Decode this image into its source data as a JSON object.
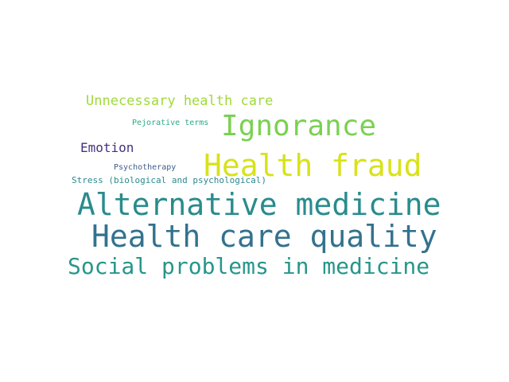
{
  "words": [
    {
      "text": "Unnecessary health care",
      "color": "#a0da39"
    },
    {
      "text": "Pejorative terms",
      "color": "#2aaa86"
    },
    {
      "text": "Ignorance",
      "color": "#7ad151"
    },
    {
      "text": "Emotion",
      "color": "#46327e"
    },
    {
      "text": "Psychotherapy",
      "color": "#3e5d8b"
    },
    {
      "text": "Health fraud",
      "color": "#d8e219"
    },
    {
      "text": "Stress (biological and psychological)",
      "color": "#2c8a8e"
    },
    {
      "text": "Alternative medicine",
      "color": "#2a8b8d"
    },
    {
      "text": "Health care quality",
      "color": "#33728e"
    },
    {
      "text": "Social problems in medicine",
      "color": "#27968a"
    }
  ]
}
